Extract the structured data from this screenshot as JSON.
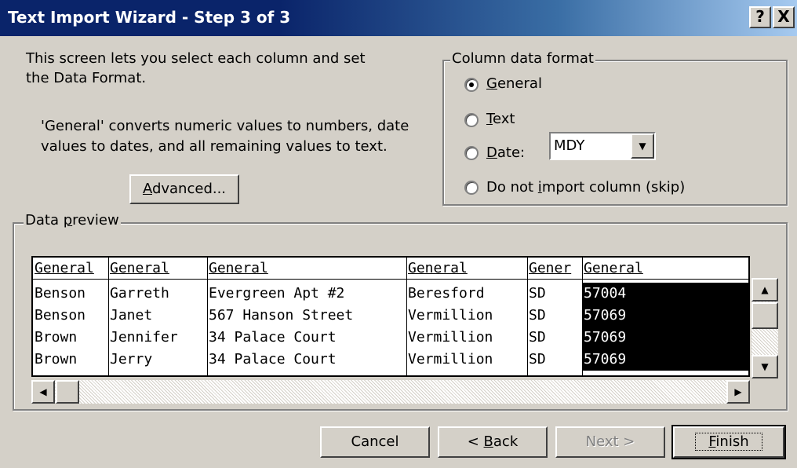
{
  "window": {
    "title": "Text Import Wizard - Step 3 of 3",
    "help_label": "?",
    "close_label": "X"
  },
  "intro": {
    "line1": "This screen lets you select each column and set",
    "line2": "the Data Format.",
    "desc1": "'General' converts numeric values to numbers, date",
    "desc2": "values to dates, and all remaining values to text."
  },
  "advanced": {
    "pre": "",
    "u": "A",
    "post": "dvanced..."
  },
  "column_format": {
    "legend": "Column data format",
    "general": {
      "u": "G",
      "post": "eneral",
      "checked": true
    },
    "text": {
      "u": "T",
      "post": "ext",
      "checked": false
    },
    "date": {
      "u": "D",
      "post": "ate:",
      "checked": false
    },
    "skip": {
      "pre": "Do not ",
      "u": "i",
      "post": "mport column (skip)",
      "checked": false
    },
    "date_select_value": "MDY"
  },
  "preview": {
    "legend_pre": "Data ",
    "legend_u": "p",
    "legend_post": "review",
    "headers": [
      "General",
      "General",
      "General",
      "General",
      "Gener",
      "General"
    ],
    "rows": [
      [
        "Benson",
        "Garreth",
        "Evergreen Apt #2",
        "Beresford",
        "SD",
        "57004"
      ],
      [
        "Benson",
        "Janet",
        "567 Hanson Street",
        "Vermillion",
        "SD",
        "57069"
      ],
      [
        "Brown",
        "Jennifer",
        "34 Palace Court",
        "Vermillion",
        "SD",
        "57069"
      ],
      [
        "Brown",
        "Jerry",
        "34 Palace Court",
        "Vermillion",
        "SD",
        "57069"
      ]
    ]
  },
  "buttons": {
    "cancel": "Cancel",
    "back": {
      "pre": "< ",
      "u": "B",
      "post": "ack"
    },
    "next": "Next >",
    "finish": {
      "pre": "",
      "u": "F",
      "post": "inish"
    }
  },
  "scroll": {
    "up_arrow": "▲",
    "down_arrow": "▼",
    "left_arrow": "◀",
    "right_arrow": "▶",
    "dropdown_arrow": "▼"
  }
}
